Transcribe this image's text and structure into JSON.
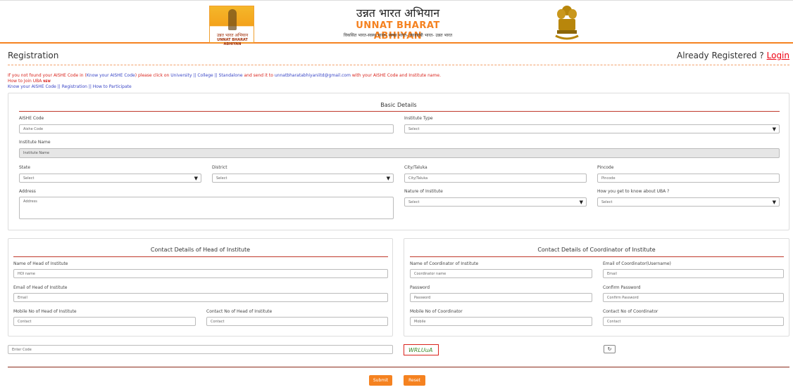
{
  "header": {
    "logo_text_hi": "उन्नत भारत अभियान",
    "logo_text_en": "UNNAT BHARAT ABHIYAN",
    "title_hi": "उन्नत भारत अभियान",
    "title_en": "UNNAT BHARAT ABHIYAN",
    "subtitle": "विकसित भारत-स्वस्थ भारत- स्वच्छ भारत- स्वावलंबी भारत- उन्नत भारत"
  },
  "page": {
    "title": "Registration",
    "already_registered": "Already Registered ?",
    "login_link": "Login"
  },
  "notes": {
    "line1_a": "If you not found your AISHE Code in (",
    "line1_link": "Know your AISHE Code",
    "line1_b": ") please click on ",
    "line1_c": "University || College || Standalone",
    "line1_d": " and send it to ",
    "line1_email": "unnatbharatabhiyaniitd@gmail.com",
    "line1_e": " with your AISHE Code and Institute name.",
    "line2": "How to Join UBA",
    "line2_badge": "NEW",
    "line3_a": "Know your AISHE Code",
    "line3_b": "Registration",
    "line3_c": "How to Participate",
    "sep": " || "
  },
  "basic": {
    "title": "Basic Details",
    "aishe_label": "AISHE Code",
    "aishe_placeholder": "Aishe Code",
    "type_label": "Institute Type",
    "type_value": "Select",
    "name_label": "Institute Name",
    "name_value": "Institute Name",
    "state_label": "State",
    "state_value": "Select",
    "district_label": "District",
    "district_value": "Select",
    "city_label": "City/Taluka",
    "city_placeholder": "City/Taluka",
    "pincode_label": "Pincode",
    "pincode_placeholder": "Pincode",
    "address_label": "Address",
    "address_placeholder": "Address",
    "nature_label": "Nature of Institute",
    "nature_value": "Select",
    "know_label": "How you get to know about UBA ?",
    "know_value": "Select"
  },
  "head": {
    "title": "Contact Details of Head of Institute",
    "name_label": "Name of Head of Institute",
    "name_placeholder": "HOI name",
    "email_label": "Email of Head of Institute",
    "email_placeholder": "Email",
    "mobile_label": "Mobile No of Head of Institute",
    "mobile_placeholder": "Contact",
    "contact_label": "Contact No of Head of Institute",
    "contact_placeholder": "Contact"
  },
  "coord": {
    "title": "Contact Details of Coordinator of Institute",
    "name_label": "Name of Coordinator of Institute",
    "name_placeholder": "Coordinator name",
    "email_label": "Email of Coordinator(Username)",
    "email_placeholder": "Email",
    "password_label": "Password",
    "password_placeholder": "Password",
    "confirm_label": "Confirm Password",
    "confirm_placeholder": "Confirm Password",
    "mobile_label": "Mobile No of Coordinator",
    "mobile_placeholder": "Mobile",
    "contact_label": "Contact No of Coordinator",
    "contact_placeholder": "Contact"
  },
  "captcha": {
    "input_placeholder": "Enter Code",
    "code": "WRLUuA",
    "refresh_icon": "↻"
  },
  "actions": {
    "submit": "Submit",
    "reset": "Reset"
  },
  "colors": {
    "accent": "#f58220",
    "link_red": "#d9231c",
    "link_blue": "#3a46c6"
  }
}
